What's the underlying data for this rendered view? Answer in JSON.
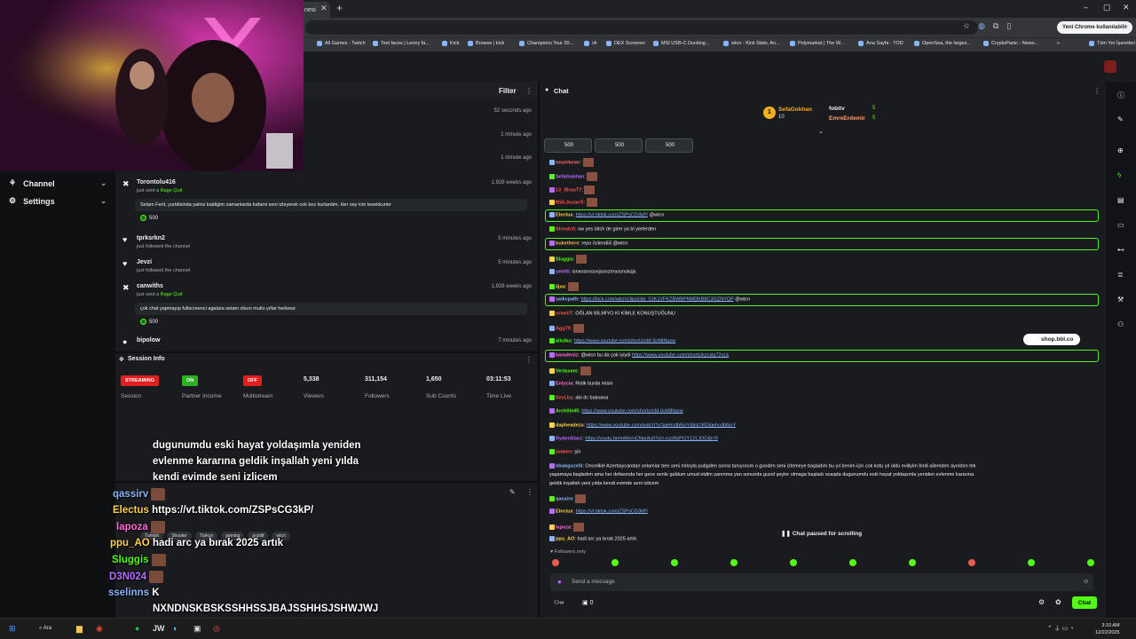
{
  "browser": {
    "tab_title": "nesi",
    "profile_label": "Yeni Chrome kullanılabilir",
    "bookmarks": [
      "All Games - Twitch",
      "Text faces | Lenny fa...",
      "Kick",
      "Browse | kick",
      "Champions Tour 20...",
      "vlr",
      "DEX Screener",
      "MSI USB-C Docking...",
      "wtcn - Kick Stats, An...",
      "Polymarket | The W...",
      "Ana Sayfa - TOD",
      "OpenSea, the larges...",
      "CryptoPanic - News...",
      "»",
      "Tüm Yer İşaretleri"
    ]
  },
  "nav": {
    "channel": "Channel",
    "settings": "Settings"
  },
  "feed": {
    "filter": "Filter",
    "times_top": [
      "52 seconds ago",
      "1 minute ago",
      "1 minute ago"
    ],
    "rows": [
      {
        "name": "Torontolu416",
        "action": "just sent a",
        "item": "Rage Quit",
        "time": "1,928 weeks ago",
        "msg": "Selam Ferit, yurtdisinda yalniz kaldigim zamanlarda kafami seni izleyerek cok kez kurtardim. Her sey icin tesekkurler",
        "amount": "500"
      },
      {
        "name": "tprksrkn2",
        "action": "just followed the channel",
        "time": "5 minutes ago"
      },
      {
        "name": "Jevzi",
        "action": "just followed the channel",
        "time": "5 minutes ago"
      },
      {
        "name": "canwiths",
        "action": "just sent a",
        "item": "Rage Quit",
        "time": "1,928 weeks ago",
        "msg": "çok chat yapmayıp fullscreenci agalara selam olsun mutlu yıllar herkese",
        "amount": "500"
      },
      {
        "name": "bipolow",
        "time": "7 minutes ago"
      }
    ]
  },
  "session": {
    "title": "Session Info",
    "items": [
      {
        "badge": "STREAMING",
        "label": "Session"
      },
      {
        "badge": "ON",
        "label": "Partner Income"
      },
      {
        "badge": "OFF",
        "label": "Multistream"
      },
      {
        "value": "5,338",
        "label": "Viewers"
      },
      {
        "value": "311,154",
        "label": "Followers"
      },
      {
        "value": "1,650",
        "label": "Sub Counts"
      },
      {
        "value": "03:11:53",
        "label": "Time Live"
      }
    ]
  },
  "stream": {
    "tags": [
      "Turkish",
      "Shooter",
      "Türkçe",
      "gaming",
      "pozitif",
      "wtcn"
    ],
    "overlay_lines": [
      {
        "user": "",
        "text": "dugunumdu eski hayat yoldaşımla yeniden"
      },
      {
        "user": "",
        "text": "evlenme kararına geldik inşallah yeni yılda"
      },
      {
        "user": "",
        "text": "kendi evimde seni izlicem"
      },
      {
        "user": "qassirv",
        "text": ""
      },
      {
        "user": "Electus",
        "text": "https://vt.tiktok.com/ZSPsCG3kP/"
      },
      {
        "user": "lapoza",
        "text": ""
      },
      {
        "user": "ppu_AO",
        "text": "hadi arc ya bırak 2025 artık"
      },
      {
        "user": "Sluggis",
        "text": ""
      },
      {
        "user": "D3N024",
        "text": ""
      },
      {
        "user": "sselinns",
        "text": "K"
      },
      {
        "user": "",
        "text": "NXNDNSKBSKSSHHSSJBAJSSHHSJSHWJWJ"
      }
    ]
  },
  "chat": {
    "title": "Chat",
    "leaderboard": [
      {
        "name": "SefaGokhan",
        "value": "10"
      },
      {
        "name": "fobitv",
        "value": "5"
      },
      {
        "name": "EmreErdemir",
        "value": "5"
      }
    ],
    "gifts": [
      "500",
      "500",
      "500"
    ],
    "messages": [
      {
        "user": "onurrkemr",
        "text": "",
        "color": "#ff6b6b",
        "emote": true
      },
      {
        "user": "SefaGokhan",
        "text": "",
        "color": "#b96bff",
        "emote": true
      },
      {
        "user": "13_iBrasT7",
        "text": "",
        "color": "#ff4d4d",
        "emote": true
      },
      {
        "user": "MAL3uzarr5",
        "text": "",
        "color": "#ff4d4d",
        "emote": true
      },
      {
        "user": "Electus",
        "text": "",
        "link": "https://vt.tiktok.com/ZSPsCG3kP/",
        "after": " @wtcn",
        "color": "#ffd24d",
        "hl": true
      },
      {
        "user": "Streatch",
        "text": "ow yes bitch de girer ya bi yerlerden",
        "color": "#ff4d4d"
      },
      {
        "user": "bukethere",
        "text": "repo özlendiiii @wtcn",
        "color": "#ffb84d",
        "hl": true
      },
      {
        "user": "Sluggis",
        "text": "",
        "color": "#53fc18",
        "emote": true
      },
      {
        "user": "sebilli",
        "text": "isnxosnxsoxjsoozrnsosnsksja",
        "color": "#b96bff"
      },
      {
        "user": "lijux",
        "text": "",
        "color": "#ffd24d",
        "emote": true
      },
      {
        "user": "saikcpath",
        "text": "",
        "link": "https://kick.com/wtcn/clips/clip_01K1VFKZBWBPNMDKB8C3GZNYQP",
        "after": " @wtcn",
        "color": "#8ab4f8",
        "hl": true
      },
      {
        "user": "orwellT",
        "text": "OĞLAN BİLMİYO Kİ KİMLE KONUŞTUĞUNU",
        "color": "#ff4d4d"
      },
      {
        "user": "Agg70",
        "text": "",
        "color": "#ff4d4d",
        "emote": true
      },
      {
        "user": "aliutku",
        "text": "",
        "link": "https://www.youtube.com/shorts/oM-0oMjNgxw",
        "after": "",
        "color": "#53fc18"
      },
      {
        "user": "karadeniz",
        "text": "@wtcn bu da çok iyiydi ",
        "link": "https://www.youtube.com/shorts/kzcxlg72vLk",
        "after": "",
        "color": "#ff6bd5",
        "hl": true
      },
      {
        "user": "Vertaxam",
        "text": "",
        "color": "#53fc18",
        "emote": true
      },
      {
        "user": "Enlycia",
        "text": "Ridik burda misin",
        "color": "#ff6bd5"
      },
      {
        "user": "SezLby",
        "text": "abi dc baksana",
        "color": "#ff4d4d"
      },
      {
        "user": "Archilie45",
        "text": "",
        "link": "https://www.youtube.com/shorts/oM-0oMjNgxw",
        "after": "",
        "color": "#53fc18"
      },
      {
        "user": "dapheadezu",
        "text": "",
        "link": "https://www.youtube.com/watch?v=igehcdbl5oY&list=RDigehcdbl5oY",
        "after": "",
        "color": "#ffd24d"
      },
      {
        "user": "RydenStarz",
        "text": "",
        "link": "https://youtu.be/mWemCNprAs0?si=-nzzKkPt1Y121JOC&t=9",
        "after": "",
        "color": "#b96bff"
      },
      {
        "user": "jwaken",
        "text": "şiir",
        "color": "#ff4d4d"
      },
      {
        "user": "ldrakgozelli",
        "text": "Oncelikle Azerbaycandan selamlar ben seni mitoyla pubgden sonra tanıyorum o gunden seni izlemeye başladım bu yıl benim için cok kotu yıl oldu evlilyim birdi ailemden ayrıldım tek",
        "color": "#8ab4f8"
      },
      {
        "user": "",
        "text": "yaşamaya başladım ama her defasında her gece senle guldum umud etdim yanınma yan sonunda guzel şeyler olmaga başladı ocaqda dugunumdu eski hayat yoldaşımla yeniden evlenme kararına",
        "color": "#efeff1"
      },
      {
        "user": "",
        "text": "geldik inşallah yeni yılda kendi evimde seni izlicem",
        "color": "#efeff1"
      },
      {
        "user": "qassirv",
        "text": "",
        "color": "#8ab4f8",
        "emote": true
      },
      {
        "user": "Electus",
        "text": "",
        "link": "https://vt.tiktok.com/ZSPsCG3kP/",
        "after": "",
        "color": "#ffd24d"
      },
      {
        "user": "lapoza",
        "text": "",
        "color": "#ff6bd5",
        "emote": true
      },
      {
        "user": "ppu_AO",
        "text": "hadi arc ya bırak 2025 artık",
        "color": "#ffd24d"
      }
    ],
    "paused": "Chat paused for scrolling",
    "followers_only": "Followers only",
    "input_placeholder": "Send a message",
    "send_label": "Chat",
    "footer_count": "0",
    "shop": "shop.bbl.co"
  },
  "taskbar": {
    "search": "Ara",
    "time": "3:10 AM",
    "date": "12/22/2025"
  }
}
